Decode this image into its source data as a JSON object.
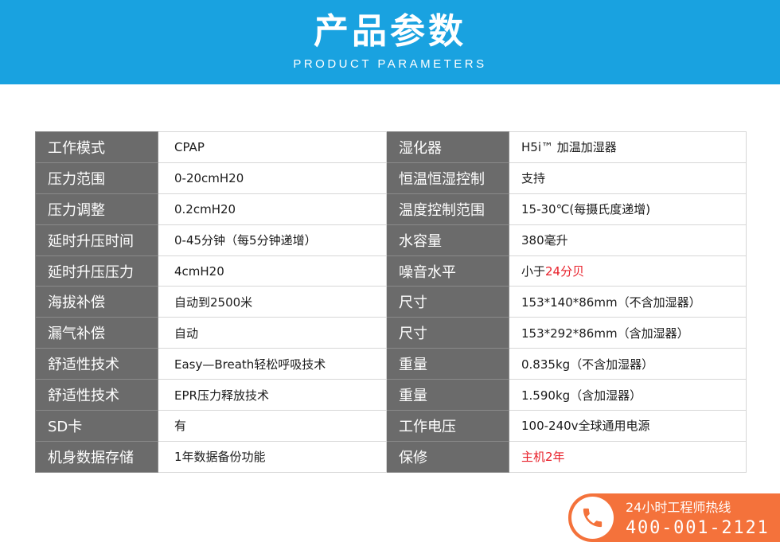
{
  "header": {
    "title": "产品参数",
    "subtitle": "PRODUCT PARAMETERS"
  },
  "params": [
    {
      "label": "工作模式",
      "value": "CPAP",
      "label2": "湿化器",
      "value2": "H5i™ 加温加湿器"
    },
    {
      "label": "压力范围",
      "value": "0-20cmH20",
      "label2": "恒温恒湿控制",
      "value2": "支持"
    },
    {
      "label": "压力调整",
      "value": "0.2cmH20",
      "label2": "温度控制范围",
      "value2": "15-30℃(每摄氏度递增)"
    },
    {
      "label": "延时升压时间",
      "value": "0-45分钟（每5分钟递增）",
      "label2": "水容量",
      "value2": "380毫升"
    },
    {
      "label": "延时升压压力",
      "value": "4cmH20",
      "label2": "噪音水平",
      "value2_prefix": "小于",
      "value2_highlight": "24分贝"
    },
    {
      "label": "海拔补偿",
      "value": "自动到2500米",
      "label2": "尺寸",
      "value2": "153*140*86mm（不含加湿器）"
    },
    {
      "label": "漏气补偿",
      "value": "自动",
      "label2": "尺寸",
      "value2": "153*292*86mm（含加湿器）"
    },
    {
      "label": "舒适性技术",
      "value": "Easy—Breath轻松呼吸技术",
      "label2": "重量",
      "value2": "0.835kg（不含加湿器）"
    },
    {
      "label": "舒适性技术",
      "value": "EPR压力释放技术",
      "label2": "重量",
      "value2": "1.590kg（含加湿器）"
    },
    {
      "label": "SD卡",
      "value": "有",
      "label2": "工作电压",
      "value2": "100-240v全球通用电源"
    },
    {
      "label": "机身数据存储",
      "value": "1年数据备份功能",
      "label2": "保修",
      "value2_highlight": "主机2年"
    }
  ],
  "hotline": {
    "label": "24小时工程师热线",
    "number": "400-001-2121",
    "icon": "phone-icon"
  },
  "colors": {
    "banner": "#19a2e0",
    "label_cell": "#6b6b6b",
    "highlight": "#e8202a",
    "hotline": "#f4723b"
  }
}
